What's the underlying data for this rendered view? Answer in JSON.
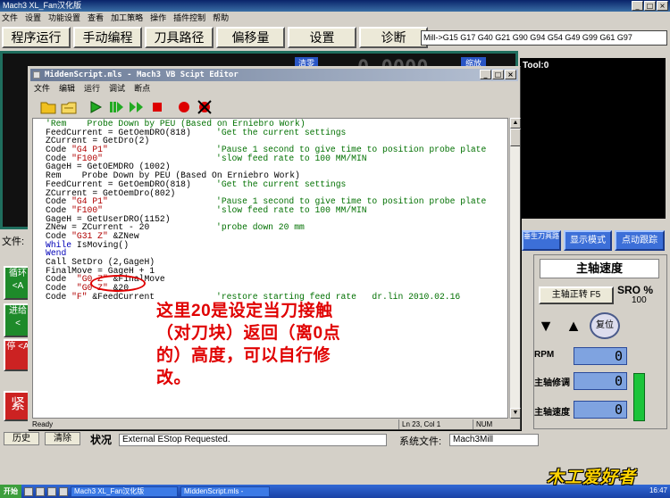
{
  "mach": {
    "title": "Mach3 XL_Fan汉化版",
    "menu": [
      "文件",
      "设置",
      "功能设置",
      "查看",
      "加工策略",
      "操作",
      "插件控制",
      "帮助"
    ],
    "tabs": [
      "程序运行",
      "手动编程",
      "刀具路径",
      "偏移量",
      "设置",
      "诊断"
    ],
    "gcode_line": "Mill->G15 G17 G40 G21 G90 G94 G54 G49 G99 G61 G97",
    "tool_label": "Tool:0",
    "dro_partial": "0.0000",
    "chip_left": "清零",
    "chip_right": "缩放",
    "file_label": "文件:",
    "left_buttons": [
      "循环 <A",
      "进给 <",
      "停 <A",
      "紧"
    ],
    "right_buttons": [
      "垂生刀具路径",
      "显示模式",
      "点动跟踪"
    ],
    "spindle": {
      "title": "主轴速度",
      "cw_button": "主轴正转 F5",
      "sro_label": "SRO %",
      "sro_value": "100",
      "reset_label": "复位",
      "rpm_label": "RPM",
      "rpm_value": "0",
      "override_label": "主轴修调",
      "override_value": "0",
      "speed_label": "主轴速度",
      "speed_value": "0"
    },
    "bottom": {
      "history_button": "历史",
      "clear_button": "清除",
      "status_label": "状况",
      "status_message": "External EStop Requested.",
      "profile_label": "系统文件:",
      "profile_value": "Mach3Mill"
    },
    "taskbar": {
      "start": "开始",
      "items": [
        "Mach3 XL_Fan汉化版",
        "MiddenScript.mls -"
      ],
      "clock": "16:47"
    },
    "watermark": "木工爱好者"
  },
  "editor": {
    "title": "MiddenScript.mls - Mach3 VB Scipt Editor",
    "menu": [
      "文件",
      "编辑",
      "运行",
      "调试",
      "断点"
    ],
    "toolbar": [
      {
        "icon": "open-folder-icon",
        "color": "#e8b400"
      },
      {
        "icon": "open-file-icon",
        "color": "#e8b400"
      },
      {
        "icon": "run-icon",
        "color": "#22aa22"
      },
      {
        "icon": "pause-icon",
        "color": "#22aa22"
      },
      {
        "icon": "step-icon",
        "color": "#22aa22"
      },
      {
        "icon": "stop-icon",
        "color": "#dd0000"
      },
      {
        "icon": "breakpoint-icon",
        "color": "#dd0000"
      },
      {
        "icon": "clear-breakpoints-icon",
        "color": "#dd0000"
      }
    ],
    "status_left": "Ready",
    "status_pos": "Ln 23, Col 1",
    "status_mode": "NUM",
    "code": [
      {
        "t": "cmt",
        "code": "'Rem    Probe Down by PEU (Based on Erniebro Work)"
      },
      {
        "t": "code",
        "code": "FeedCurrent = GetOemDRO(818)",
        "comment": "'Get the current settings"
      },
      {
        "t": "code",
        "code": "ZCurrent = GetDro(2)"
      },
      {
        "t": "str",
        "kw": "Code ",
        "str": "\"G4 P1\"",
        "comment": "'Pause 1 second to give time to position probe plate"
      },
      {
        "t": "str",
        "kw": "Code ",
        "str": "\"F100\"",
        "comment": "'slow feed rate to 100 MM/MIN"
      },
      {
        "t": "code",
        "code": "GageH = GetOEMDRO (1002)"
      },
      {
        "t": "code",
        "code": "Rem    Probe Down by PEU (Based On Erniebro Work)"
      },
      {
        "t": "code",
        "code": "FeedCurrent = GetOemDRO(818)",
        "comment": "'Get the current settings"
      },
      {
        "t": "code",
        "code": "ZCurrent = GetOemDro(802)"
      },
      {
        "t": "str",
        "kw": "Code ",
        "str": "\"G4 P1\"",
        "comment": "'Pause 1 second to give time to position probe plate"
      },
      {
        "t": "str",
        "kw": "Code ",
        "str": "\"F100\"",
        "comment": "'slow feed rate to 100 MM/MIN"
      },
      {
        "t": "code",
        "code": "GageH = GetUserDRO(1152)"
      },
      {
        "t": "code",
        "code": "ZNew = ZCurrent - 20",
        "comment": "'probe down 20 mm"
      },
      {
        "t": "str",
        "kw": "Code ",
        "str": "\"G31 Z\"",
        "rest": " &ZNew"
      },
      {
        "t": "kw",
        "kw": "While",
        "rest": " IsMoving()"
      },
      {
        "t": "kw",
        "kw": "Wend",
        "rest": ""
      },
      {
        "t": "code",
        "code": "Call SetDro (2,GageH)"
      },
      {
        "t": "code",
        "code": "FinalMove = GageH + 1"
      },
      {
        "t": "str",
        "kw": "Code  ",
        "str": "\"G0 Z\"",
        "rest": " &FinalMove"
      },
      {
        "t": "str",
        "kw": "Code  ",
        "str": "\"G0 Z\"",
        "rest": " &20"
      },
      {
        "t": "str",
        "kw": "Code ",
        "str": "\"F\"",
        "rest": " &FeedCurrent",
        "comment": "'restore starting feed rate   dr.lin 2010.02.16"
      }
    ]
  },
  "annotation": {
    "text": "这里20是设定当刀接触（对刀块）返回（离0点的）高度，可以自行修改。"
  }
}
